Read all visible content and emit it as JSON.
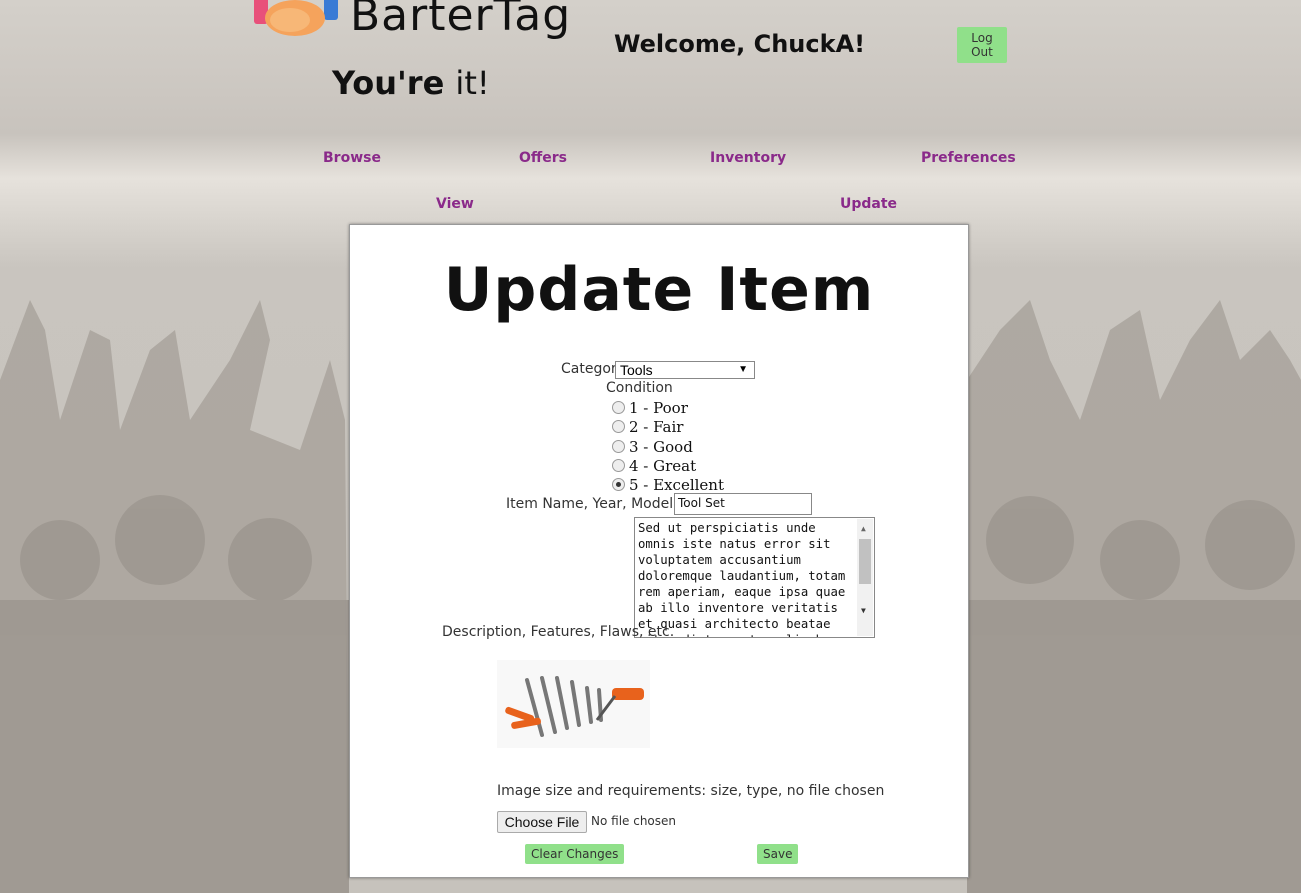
{
  "header": {
    "logo_text": "BarterTag",
    "tagline_a": "You're",
    "tagline_b": "it!",
    "welcome": "Welcome, ChuckA!",
    "logout_label": "Log Out"
  },
  "nav": {
    "primary": [
      "Browse",
      "Offers",
      "Inventory",
      "Preferences"
    ],
    "secondary": [
      "View",
      "Update"
    ]
  },
  "form": {
    "title": "Update Item",
    "category_label": "Category",
    "category_value": "Tools",
    "condition_label": "Condition",
    "conditions": [
      {
        "label": "1 - Poor",
        "checked": false
      },
      {
        "label": "2 - Fair",
        "checked": false
      },
      {
        "label": "3 - Good",
        "checked": false
      },
      {
        "label": "4 - Great",
        "checked": false
      },
      {
        "label": "5 - Excellent",
        "checked": true
      }
    ],
    "name_label": "Item Name, Year, Model, etc.",
    "name_value": "Tool Set",
    "description_label": "Description, Features, Flaws, etc.",
    "description_value": "Sed ut perspiciatis unde omnis iste natus error sit voluptatem accusantium doloremque laudantium, totam rem aperiam, eaque ipsa quae ab illo inventore veritatis et quasi architecto beatae vitae dicta sunt explicabo",
    "image_requirements": "Image size and requirements: size, type, no file chosen",
    "choose_file_label": "Choose File",
    "no_file_text": "No file chosen",
    "clear_label": "Clear Changes",
    "save_label": "Save"
  },
  "colors": {
    "accent_green": "#90e08a",
    "nav_link": "#8a2a8a"
  }
}
